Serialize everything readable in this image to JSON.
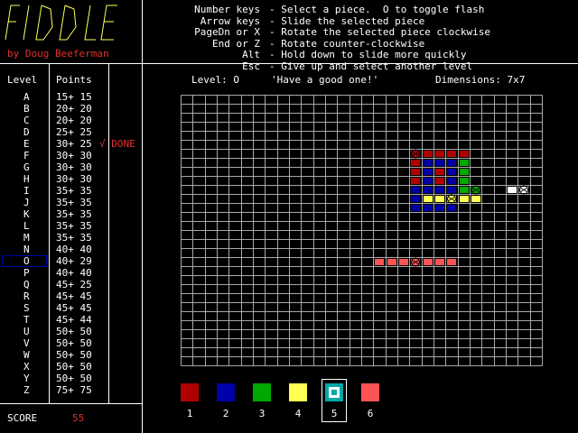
{
  "app": {
    "title": "FIDDLE",
    "author": "by Doug Beeferman"
  },
  "keys": [
    {
      "key": "Number keys",
      "desc": "- Select a piece.  O to toggle flash"
    },
    {
      "key": "Arrow keys",
      "desc": "- Slide the selected piece"
    },
    {
      "key": "PageDn or X",
      "desc": "- Rotate the selected piece clockwise"
    },
    {
      "key": "End or Z",
      "desc": "- Rotate counter-clockwise"
    },
    {
      "key": "Alt",
      "desc": "- Hold down to slide more quickly"
    },
    {
      "key": "Esc",
      "desc": "- Give up and select another level"
    }
  ],
  "levels": {
    "header_level": "Level",
    "header_points": "Points",
    "items": [
      {
        "level": "A",
        "points": "15+ 15",
        "status": ""
      },
      {
        "level": "B",
        "points": "20+ 20",
        "status": ""
      },
      {
        "level": "C",
        "points": "20+ 20",
        "status": ""
      },
      {
        "level": "D",
        "points": "25+ 25",
        "status": ""
      },
      {
        "level": "E",
        "points": "30+ 25",
        "status": "√ DONE"
      },
      {
        "level": "F",
        "points": "30+ 30",
        "status": ""
      },
      {
        "level": "G",
        "points": "30+ 30",
        "status": ""
      },
      {
        "level": "H",
        "points": "30+ 30",
        "status": ""
      },
      {
        "level": "I",
        "points": "35+ 35",
        "status": ""
      },
      {
        "level": "J",
        "points": "35+ 35",
        "status": ""
      },
      {
        "level": "K",
        "points": "35+ 35",
        "status": ""
      },
      {
        "level": "L",
        "points": "35+ 35",
        "status": ""
      },
      {
        "level": "M",
        "points": "35+ 35",
        "status": ""
      },
      {
        "level": "N",
        "points": "40+ 40",
        "status": ""
      },
      {
        "level": "O",
        "points": "40+ 29",
        "status": ""
      },
      {
        "level": "P",
        "points": "40+ 40",
        "status": ""
      },
      {
        "level": "Q",
        "points": "45+ 25",
        "status": ""
      },
      {
        "level": "R",
        "points": "45+ 45",
        "status": ""
      },
      {
        "level": "S",
        "points": "45+ 45",
        "status": ""
      },
      {
        "level": "T",
        "points": "45+ 44",
        "status": ""
      },
      {
        "level": "U",
        "points": "50+ 50",
        "status": ""
      },
      {
        "level": "V",
        "points": "50+ 50",
        "status": ""
      },
      {
        "level": "W",
        "points": "50+ 50",
        "status": ""
      },
      {
        "level": "X",
        "points": "50+ 50",
        "status": ""
      },
      {
        "level": "Y",
        "points": "50+ 50",
        "status": ""
      },
      {
        "level": "Z",
        "points": "75+ 75",
        "status": ""
      }
    ],
    "selected": "O"
  },
  "score": {
    "label": "SCORE",
    "value": "55"
  },
  "status_line": {
    "level": "Level: O",
    "message": "'Have a good one!'",
    "dimensions": "Dimensions: 7x7"
  },
  "board": {
    "cols": 30,
    "rows": 30,
    "cells": [
      {
        "c": 19,
        "r": 6,
        "color": "red",
        "mark": "x"
      },
      {
        "c": 20,
        "r": 6,
        "color": "red"
      },
      {
        "c": 21,
        "r": 6,
        "color": "red"
      },
      {
        "c": 22,
        "r": 6,
        "color": "red"
      },
      {
        "c": 23,
        "r": 6,
        "color": "red"
      },
      {
        "c": 19,
        "r": 7,
        "color": "red"
      },
      {
        "c": 20,
        "r": 7,
        "color": "blue"
      },
      {
        "c": 21,
        "r": 7,
        "color": "blue"
      },
      {
        "c": 22,
        "r": 7,
        "color": "blue"
      },
      {
        "c": 23,
        "r": 7,
        "color": "green"
      },
      {
        "c": 19,
        "r": 8,
        "color": "red"
      },
      {
        "c": 20,
        "r": 8,
        "color": "blue"
      },
      {
        "c": 21,
        "r": 8,
        "color": "red"
      },
      {
        "c": 22,
        "r": 8,
        "color": "blue"
      },
      {
        "c": 23,
        "r": 8,
        "color": "green"
      },
      {
        "c": 19,
        "r": 9,
        "color": "red"
      },
      {
        "c": 20,
        "r": 9,
        "color": "blue"
      },
      {
        "c": 21,
        "r": 9,
        "color": "red"
      },
      {
        "c": 22,
        "r": 9,
        "color": "blue"
      },
      {
        "c": 23,
        "r": 9,
        "color": "green"
      },
      {
        "c": 19,
        "r": 10,
        "color": "blue"
      },
      {
        "c": 20,
        "r": 10,
        "color": "blue"
      },
      {
        "c": 21,
        "r": 10,
        "color": "blue"
      },
      {
        "c": 22,
        "r": 10,
        "color": "blue"
      },
      {
        "c": 23,
        "r": 10,
        "color": "green"
      },
      {
        "c": 24,
        "r": 10,
        "color": "green",
        "mark": "x"
      },
      {
        "c": 27,
        "r": 10,
        "color": "white"
      },
      {
        "c": 28,
        "r": 10,
        "color": "white",
        "mark": "x"
      },
      {
        "c": 19,
        "r": 11,
        "color": "blue"
      },
      {
        "c": 20,
        "r": 11,
        "color": "yellow"
      },
      {
        "c": 21,
        "r": 11,
        "color": "yellow"
      },
      {
        "c": 22,
        "r": 11,
        "color": "yellow",
        "mark": "x"
      },
      {
        "c": 23,
        "r": 11,
        "color": "yellow"
      },
      {
        "c": 24,
        "r": 11,
        "color": "yellow"
      },
      {
        "c": 19,
        "r": 12,
        "color": "blue"
      },
      {
        "c": 20,
        "r": 12,
        "color": "blue"
      },
      {
        "c": 21,
        "r": 12,
        "color": "blue"
      },
      {
        "c": 22,
        "r": 12,
        "color": "blue"
      },
      {
        "c": 16,
        "r": 18,
        "color": "salmon"
      },
      {
        "c": 17,
        "r": 18,
        "color": "salmon"
      },
      {
        "c": 18,
        "r": 18,
        "color": "salmon"
      },
      {
        "c": 19,
        "r": 18,
        "color": "salmon",
        "mark": "x"
      },
      {
        "c": 20,
        "r": 18,
        "color": "salmon"
      },
      {
        "c": 21,
        "r": 18,
        "color": "salmon"
      },
      {
        "c": 22,
        "r": 18,
        "color": "salmon"
      }
    ]
  },
  "colors": {
    "red": "#b00000",
    "blue": "#0000a8",
    "green": "#00a800",
    "yellow": "#ffff54",
    "white": "#ffffff",
    "salmon": "#fc5454",
    "grid": "#a8a8a8",
    "score": "#e03030",
    "highlight": "#0000a8",
    "select_cyan": "#00a8a8"
  },
  "palette": [
    {
      "num": "1",
      "color": "red"
    },
    {
      "num": "2",
      "color": "blue"
    },
    {
      "num": "3",
      "color": "green"
    },
    {
      "num": "4",
      "color": "yellow"
    },
    {
      "num": "5",
      "color": "white",
      "selected": true
    },
    {
      "num": "6",
      "color": "salmon"
    }
  ]
}
